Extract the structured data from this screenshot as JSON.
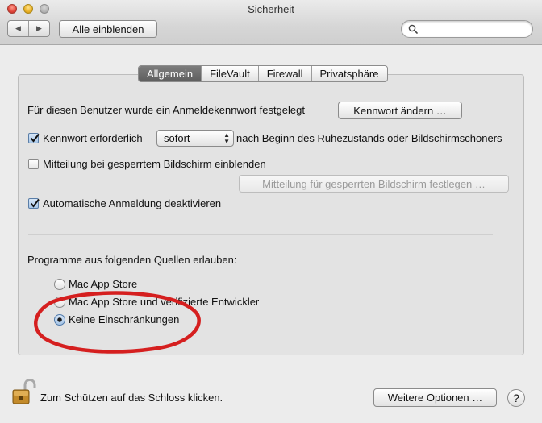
{
  "window": {
    "title": "Sicherheit"
  },
  "toolbar": {
    "back_label": "◀",
    "forward_label": "▶",
    "show_all_label": "Alle einblenden",
    "search": {
      "value": "",
      "placeholder": ""
    }
  },
  "tabs": [
    {
      "label": "Allgemein",
      "active": true
    },
    {
      "label": "FileVault",
      "active": false
    },
    {
      "label": "Firewall",
      "active": false
    },
    {
      "label": "Privatsphäre",
      "active": false
    }
  ],
  "general": {
    "password_set_text": "Für diesen Benutzer wurde ein Anmeldekennwort festgelegt",
    "change_password_label": "Kennwort ändern …",
    "require_password": {
      "checked": true,
      "label": "Kennwort erforderlich",
      "select_value": "sofort",
      "suffix": "nach Beginn des Ruhezustands oder Bildschirmschoners"
    },
    "show_message": {
      "checked": false,
      "label": "Mitteilung bei gesperrtem Bildschirm einblenden"
    },
    "set_message_label": "Mitteilung für gesperrten Bildschirm festlegen …",
    "disable_autologin": {
      "checked": true,
      "label": "Automatische Anmeldung deaktivieren"
    }
  },
  "sources": {
    "heading": "Programme aus folgenden Quellen erlauben:",
    "options": [
      {
        "label": "Mac App Store",
        "selected": false
      },
      {
        "label": "Mac App Store und verifizierte Entwickler",
        "selected": false
      },
      {
        "label": "Keine Einschränkungen",
        "selected": true
      }
    ]
  },
  "footer": {
    "lock_text": "Zum Schützen auf das Schloss klicken.",
    "advanced_label": "Weitere Optionen …",
    "help_label": "?"
  },
  "colors": {
    "annotation": "#d51f1f",
    "active_tab": "#6a6a6a",
    "checkbox_accent": "#5a7ea8"
  },
  "icons": {
    "lock": "lock-open-icon",
    "search": "magnifier-icon"
  }
}
